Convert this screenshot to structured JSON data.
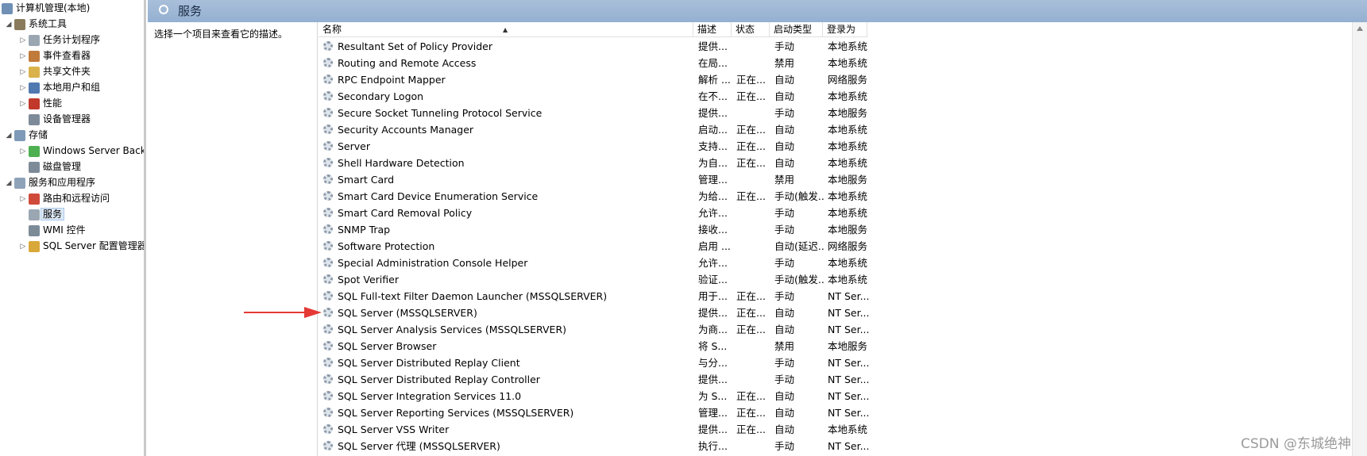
{
  "nav": {
    "items": [
      {
        "label": "计算机管理(本地)",
        "arrow": "",
        "icon": "computer-icon",
        "depth": 0,
        "color": "#6f8fb5"
      },
      {
        "label": "系统工具",
        "arrow": "◢",
        "icon": "tools-icon",
        "depth": 1,
        "color": "#8a7b5c"
      },
      {
        "label": "任务计划程序",
        "arrow": "▷",
        "icon": "clock-icon",
        "depth": 2,
        "color": "#9aa7b3"
      },
      {
        "label": "事件查看器",
        "arrow": "▷",
        "icon": "event-viewer-icon",
        "depth": 2,
        "color": "#c07a3a"
      },
      {
        "label": "共享文件夹",
        "arrow": "▷",
        "icon": "shared-folder-icon",
        "depth": 2,
        "color": "#d9b24a"
      },
      {
        "label": "本地用户和组",
        "arrow": "▷",
        "icon": "users-icon",
        "depth": 2,
        "color": "#4f79b0"
      },
      {
        "label": "性能",
        "arrow": "▷",
        "icon": "performance-icon",
        "depth": 2,
        "color": "#c0392b"
      },
      {
        "label": "设备管理器",
        "arrow": "",
        "icon": "device-manager-icon",
        "depth": 2,
        "color": "#7d8b99"
      },
      {
        "label": "存储",
        "arrow": "◢",
        "icon": "storage-icon",
        "depth": 1,
        "color": "#7f9ab8"
      },
      {
        "label": "Windows Server Backup",
        "arrow": "▷",
        "icon": "backup-icon",
        "depth": 2,
        "color": "#4caf50"
      },
      {
        "label": "磁盘管理",
        "arrow": "",
        "icon": "disk-icon",
        "depth": 2,
        "color": "#7d8b99"
      },
      {
        "label": "服务和应用程序",
        "arrow": "◢",
        "icon": "services-apps-icon",
        "depth": 1,
        "color": "#8fa3b8"
      },
      {
        "label": "路由和远程访问",
        "arrow": "▷",
        "icon": "routing-icon",
        "depth": 2,
        "color": "#d04a3a"
      },
      {
        "label": "服务",
        "arrow": "",
        "icon": "gear-icon",
        "depth": 2,
        "color": "#9aa7b3",
        "selected": true
      },
      {
        "label": "WMI 控件",
        "arrow": "",
        "icon": "wmi-icon",
        "depth": 2,
        "color": "#7d8b99"
      },
      {
        "label": "SQL Server 配置管理器",
        "arrow": "▷",
        "icon": "sql-config-icon",
        "depth": 2,
        "color": "#d9a83a"
      }
    ]
  },
  "header": {
    "title": "服务",
    "icon": "services-gear-icon"
  },
  "desc_pane": {
    "text": "选择一个项目来查看它的描述。"
  },
  "columns": [
    "名称",
    "描述",
    "状态",
    "启动类型",
    "登录为"
  ],
  "rows": [
    [
      "Resultant Set of Policy Provider",
      "提供...",
      "",
      "手动",
      "本地系统"
    ],
    [
      "Routing and Remote Access",
      "在局...",
      "",
      "禁用",
      "本地系统"
    ],
    [
      "RPC Endpoint Mapper",
      "解析 ...",
      "正在...",
      "自动",
      "网络服务"
    ],
    [
      "Secondary Logon",
      "在不...",
      "正在...",
      "自动",
      "本地系统"
    ],
    [
      "Secure Socket Tunneling Protocol Service",
      "提供...",
      "",
      "手动",
      "本地服务"
    ],
    [
      "Security Accounts Manager",
      "启动...",
      "正在...",
      "自动",
      "本地系统"
    ],
    [
      "Server",
      "支持...",
      "正在...",
      "自动",
      "本地系统"
    ],
    [
      "Shell Hardware Detection",
      "为自...",
      "正在...",
      "自动",
      "本地系统"
    ],
    [
      "Smart Card",
      "管理...",
      "",
      "禁用",
      "本地服务"
    ],
    [
      "Smart Card Device Enumeration Service",
      "为给...",
      "正在...",
      "手动(触发...",
      "本地系统"
    ],
    [
      "Smart Card Removal Policy",
      "允许...",
      "",
      "手动",
      "本地系统"
    ],
    [
      "SNMP Trap",
      "接收...",
      "",
      "手动",
      "本地服务"
    ],
    [
      "Software Protection",
      "启用 ...",
      "",
      "自动(延迟...",
      "网络服务"
    ],
    [
      "Special Administration Console Helper",
      "允许...",
      "",
      "手动",
      "本地系统"
    ],
    [
      "Spot Verifier",
      "验证...",
      "",
      "手动(触发...",
      "本地系统"
    ],
    [
      "SQL Full-text Filter Daemon Launcher (MSSQLSERVER)",
      "用于...",
      "正在...",
      "手动",
      "NT Ser..."
    ],
    [
      "SQL Server (MSSQLSERVER)",
      "提供...",
      "正在...",
      "自动",
      "NT Ser..."
    ],
    [
      "SQL Server Analysis Services (MSSQLSERVER)",
      "为商...",
      "正在...",
      "自动",
      "NT Ser..."
    ],
    [
      "SQL Server Browser",
      "将 S...",
      "",
      "禁用",
      "本地服务"
    ],
    [
      "SQL Server Distributed Replay Client",
      "与分...",
      "",
      "手动",
      "NT Ser..."
    ],
    [
      "SQL Server Distributed Replay Controller",
      "提供...",
      "",
      "手动",
      "NT Ser..."
    ],
    [
      "SQL Server Integration Services 11.0",
      "为 S...",
      "正在...",
      "自动",
      "NT Ser..."
    ],
    [
      "SQL Server Reporting Services (MSSQLSERVER)",
      "管理...",
      "正在...",
      "自动",
      "NT Ser..."
    ],
    [
      "SQL Server VSS Writer",
      "提供...",
      "正在...",
      "自动",
      "本地系统"
    ],
    [
      "SQL Server 代理 (MSSQLSERVER)",
      "执行...",
      "",
      "手动",
      "NT Ser..."
    ]
  ],
  "annotation": {
    "arrow_color": "#e53935"
  },
  "watermark": "CSDN @东城绝神"
}
